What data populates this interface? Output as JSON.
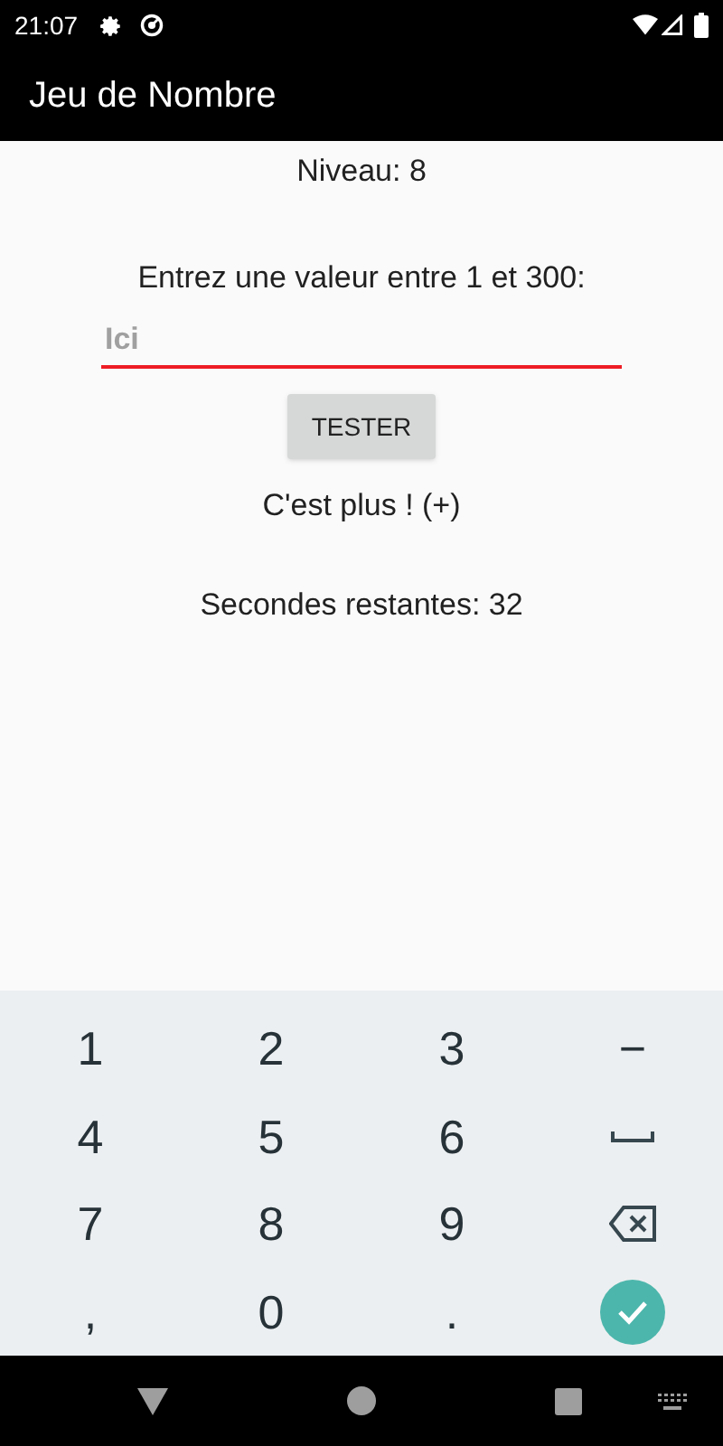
{
  "status_bar": {
    "time": "21:07"
  },
  "app_bar": {
    "title": "Jeu de Nombre"
  },
  "level_label": "Niveau: 8",
  "prompt": "Entrez une valeur entre 1 et 300:",
  "input": {
    "placeholder": "Ici"
  },
  "button": "TESTER",
  "hint": "C'est plus ! (+)",
  "timer": "Secondes restantes: 32",
  "keyboard": {
    "keys": [
      {
        "kind": "char",
        "label": "1"
      },
      {
        "kind": "char",
        "label": "2"
      },
      {
        "kind": "char",
        "label": "3"
      },
      {
        "kind": "char",
        "label": "−"
      },
      {
        "kind": "char",
        "label": "4"
      },
      {
        "kind": "char",
        "label": "5"
      },
      {
        "kind": "char",
        "label": "6"
      },
      {
        "kind": "space"
      },
      {
        "kind": "char",
        "label": "7"
      },
      {
        "kind": "char",
        "label": "8"
      },
      {
        "kind": "char",
        "label": "9"
      },
      {
        "kind": "backspace"
      },
      {
        "kind": "char",
        "label": ","
      },
      {
        "kind": "char",
        "label": "0"
      },
      {
        "kind": "char",
        "label": "."
      },
      {
        "kind": "done"
      }
    ]
  }
}
